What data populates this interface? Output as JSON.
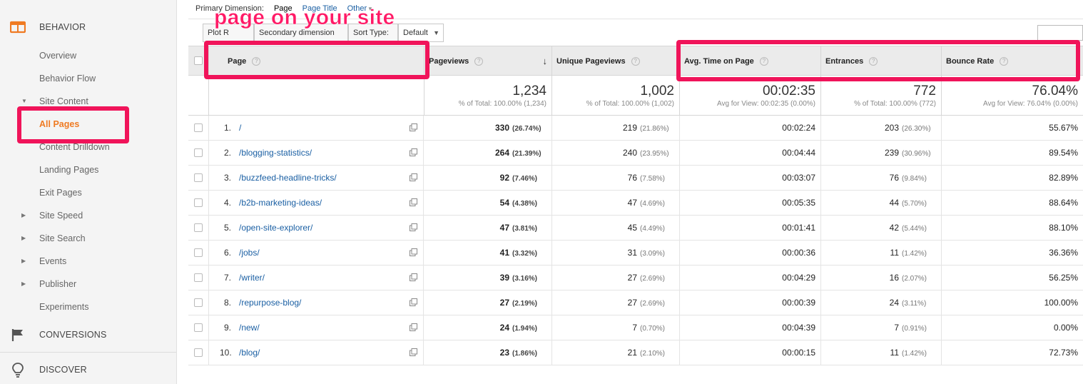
{
  "sidebar": {
    "behavior_label": "BEHAVIOR",
    "items": [
      {
        "label": "Overview"
      },
      {
        "label": "Behavior Flow"
      },
      {
        "label": "Site Content"
      },
      {
        "label": "All Pages"
      },
      {
        "label": "Content Drilldown"
      },
      {
        "label": "Landing Pages"
      },
      {
        "label": "Exit Pages"
      },
      {
        "label": "Site Speed"
      },
      {
        "label": "Site Search"
      },
      {
        "label": "Events"
      },
      {
        "label": "Publisher"
      },
      {
        "label": "Experiments"
      }
    ],
    "conversions_label": "CONVERSIONS",
    "discover_label": "DISCOVER",
    "colors": {
      "active": "#ef7a22",
      "behavior_icon": "#ef7a22"
    }
  },
  "dimension_bar": {
    "label": "Primary Dimension:",
    "selected": "Page",
    "page_title": "Page Title",
    "other": "Other"
  },
  "toolbar": {
    "plot_rows": "Plot R",
    "secondary_dimension": "Secondary dimension",
    "sort_type_label": "Sort Type:",
    "sort_type_value": "Default"
  },
  "table": {
    "headers": {
      "page": "Page",
      "pageviews": "Pageviews",
      "unique_pageviews": "Unique Pageviews",
      "avg_time": "Avg. Time on Page",
      "entrances": "Entrances",
      "bounce_rate": "Bounce Rate"
    },
    "totals": {
      "pageviews": "1,234",
      "pageviews_sub": "% of Total: 100.00% (1,234)",
      "unique_pageviews": "1,002",
      "unique_pageviews_sub": "% of Total: 100.00% (1,002)",
      "avg_time": "00:02:35",
      "avg_time_sub": "Avg for View: 00:02:35 (0.00%)",
      "entrances": "772",
      "entrances_sub": "% of Total: 100.00% (772)",
      "bounce_rate": "76.04%",
      "bounce_rate_sub": "Avg for View: 76.04% (0.00%)"
    },
    "rows": [
      {
        "idx": "1.",
        "page": "/",
        "pv": "330",
        "pv_pct": "(26.74%)",
        "upv": "219",
        "upv_pct": "(21.86%)",
        "time": "00:02:24",
        "ent": "203",
        "ent_pct": "(26.30%)",
        "br": "55.67%"
      },
      {
        "idx": "2.",
        "page": "/blogging-statistics/",
        "pv": "264",
        "pv_pct": "(21.39%)",
        "upv": "240",
        "upv_pct": "(23.95%)",
        "time": "00:04:44",
        "ent": "239",
        "ent_pct": "(30.96%)",
        "br": "89.54%"
      },
      {
        "idx": "3.",
        "page": "/buzzfeed-headline-tricks/",
        "pv": "92",
        "pv_pct": "(7.46%)",
        "upv": "76",
        "upv_pct": "(7.58%)",
        "time": "00:03:07",
        "ent": "76",
        "ent_pct": "(9.84%)",
        "br": "82.89%"
      },
      {
        "idx": "4.",
        "page": "/b2b-marketing-ideas/",
        "pv": "54",
        "pv_pct": "(4.38%)",
        "upv": "47",
        "upv_pct": "(4.69%)",
        "time": "00:05:35",
        "ent": "44",
        "ent_pct": "(5.70%)",
        "br": "88.64%"
      },
      {
        "idx": "5.",
        "page": "/open-site-explorer/",
        "pv": "47",
        "pv_pct": "(3.81%)",
        "upv": "45",
        "upv_pct": "(4.49%)",
        "time": "00:01:41",
        "ent": "42",
        "ent_pct": "(5.44%)",
        "br": "88.10%"
      },
      {
        "idx": "6.",
        "page": "/jobs/",
        "pv": "41",
        "pv_pct": "(3.32%)",
        "upv": "31",
        "upv_pct": "(3.09%)",
        "time": "00:00:36",
        "ent": "11",
        "ent_pct": "(1.42%)",
        "br": "36.36%"
      },
      {
        "idx": "7.",
        "page": "/writer/",
        "pv": "39",
        "pv_pct": "(3.16%)",
        "upv": "27",
        "upv_pct": "(2.69%)",
        "time": "00:04:29",
        "ent": "16",
        "ent_pct": "(2.07%)",
        "br": "56.25%"
      },
      {
        "idx": "8.",
        "page": "/repurpose-blog/",
        "pv": "27",
        "pv_pct": "(2.19%)",
        "upv": "27",
        "upv_pct": "(2.69%)",
        "time": "00:00:39",
        "ent": "24",
        "ent_pct": "(3.11%)",
        "br": "100.00%"
      },
      {
        "idx": "9.",
        "page": "/new/",
        "pv": "24",
        "pv_pct": "(1.94%)",
        "upv": "7",
        "upv_pct": "(0.70%)",
        "time": "00:04:39",
        "ent": "7",
        "ent_pct": "(0.91%)",
        "br": "0.00%"
      },
      {
        "idx": "10.",
        "page": "/blog/",
        "pv": "23",
        "pv_pct": "(1.86%)",
        "upv": "21",
        "upv_pct": "(2.10%)",
        "time": "00:00:15",
        "ent": "11",
        "ent_pct": "(1.42%)",
        "br": "72.73%"
      }
    ]
  },
  "annotation": {
    "text": "page on your site",
    "color": "#f0145a"
  },
  "icons": {
    "behavior": "behavior-icon",
    "conversions": "flag-icon",
    "discover": "lightbulb-icon",
    "external_link": "external-link-icon",
    "help": "help-icon",
    "sort_down": "sort-down-icon"
  }
}
